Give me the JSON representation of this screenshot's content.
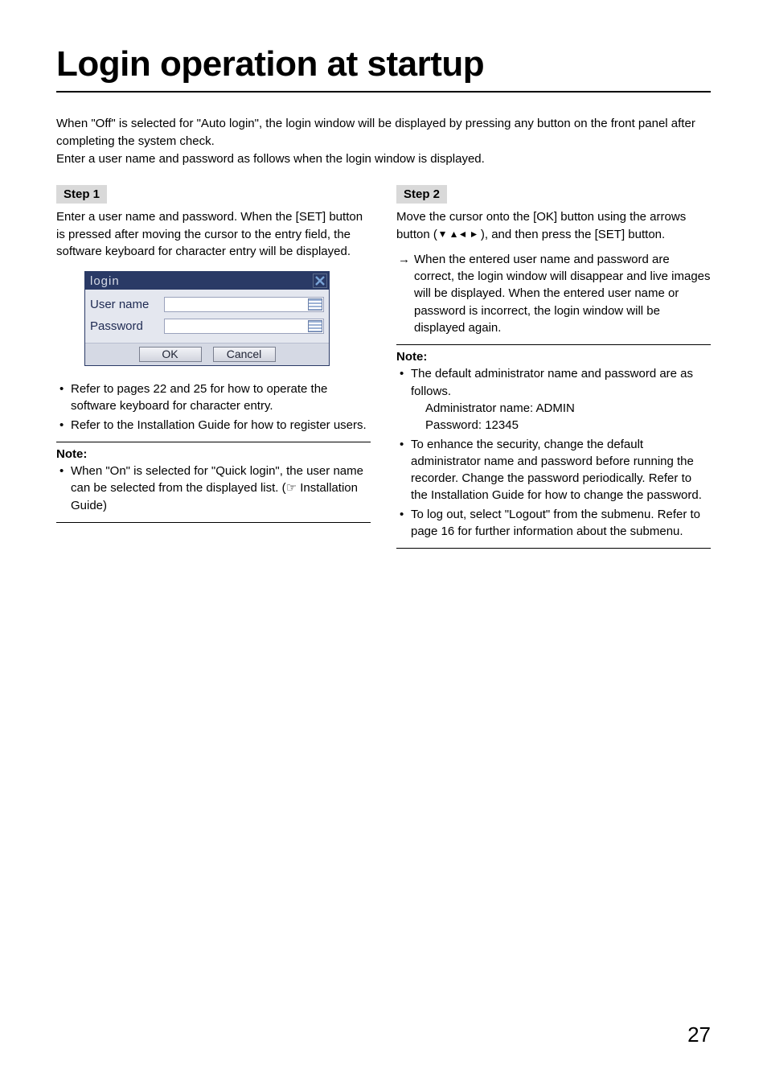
{
  "title": "Login operation at startup",
  "intro": "When \"Off\" is selected for \"Auto login\", the login window will be displayed by pressing any button on the front panel after completing the system check.\nEnter a user name and password as follows when the login window is displayed.",
  "left": {
    "step_label": "Step 1",
    "step_text": "Enter a user name and password. When the [SET] button is pressed after moving the cursor to the entry field, the software keyboard for character entry will be displayed.",
    "fig": {
      "title": "login",
      "user_label": "User name",
      "pass_label": "Password",
      "ok": "OK",
      "cancel": "Cancel"
    },
    "bullets": [
      "Refer to pages 22 and 25 for how to operate the software keyboard for character entry.",
      "Refer to the Installation Guide for how to register users."
    ],
    "note_label": "Note:",
    "note_bullet": "When \"On\" is selected for \"Quick login\", the user name can be selected from the displayed list. (☞ Installation Guide)"
  },
  "right": {
    "step_label": "Step 2",
    "step_text_a": "Move the cursor onto the [OK] button using the arrows button (",
    "step_text_b": "), and then press the [SET] button.",
    "arrow_text": "When the entered user name and password are correct, the login window will disappear and live images will be displayed. When the entered user name or password is incorrect, the login window will be displayed again.",
    "note_label": "Note:",
    "note_bullets": [
      "The default administrator name and password are as follows.",
      "To enhance the security, change the default administrator name and password before running the recorder. Change the password periodically. Refer to the Installation Guide for how to change the password.",
      "To log out, select \"Logout\" from the submenu. Refer to page 16 for further information about the submenu."
    ],
    "admin_line1": "Administrator name: ADMIN",
    "admin_line2": "Password: 12345"
  },
  "page_number": "27"
}
